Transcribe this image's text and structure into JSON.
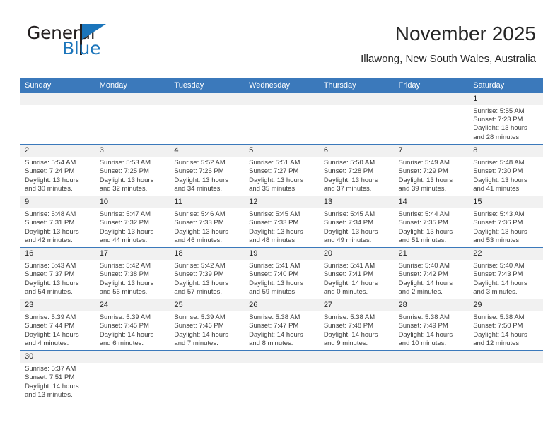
{
  "brand": {
    "name_part1": "General",
    "name_part2": "Blue",
    "flag_icon": "triangle-flag-icon",
    "accent_color": "#1b75bb"
  },
  "header": {
    "title": "November 2025",
    "subtitle": "Illawong, New South Wales, Australia"
  },
  "calendar": {
    "header_color": "#3b79bb",
    "daynum_band_color": "#f1f1f1",
    "weekdays": [
      "Sunday",
      "Monday",
      "Tuesday",
      "Wednesday",
      "Thursday",
      "Friday",
      "Saturday"
    ],
    "weeks": [
      [
        {
          "day": ""
        },
        {
          "day": ""
        },
        {
          "day": ""
        },
        {
          "day": ""
        },
        {
          "day": ""
        },
        {
          "day": ""
        },
        {
          "day": "1",
          "sunrise": "Sunrise: 5:55 AM",
          "sunset": "Sunset: 7:23 PM",
          "daylight_line1": "Daylight: 13 hours",
          "daylight_line2": "and 28 minutes."
        }
      ],
      [
        {
          "day": "2",
          "sunrise": "Sunrise: 5:54 AM",
          "sunset": "Sunset: 7:24 PM",
          "daylight_line1": "Daylight: 13 hours",
          "daylight_line2": "and 30 minutes."
        },
        {
          "day": "3",
          "sunrise": "Sunrise: 5:53 AM",
          "sunset": "Sunset: 7:25 PM",
          "daylight_line1": "Daylight: 13 hours",
          "daylight_line2": "and 32 minutes."
        },
        {
          "day": "4",
          "sunrise": "Sunrise: 5:52 AM",
          "sunset": "Sunset: 7:26 PM",
          "daylight_line1": "Daylight: 13 hours",
          "daylight_line2": "and 34 minutes."
        },
        {
          "day": "5",
          "sunrise": "Sunrise: 5:51 AM",
          "sunset": "Sunset: 7:27 PM",
          "daylight_line1": "Daylight: 13 hours",
          "daylight_line2": "and 35 minutes."
        },
        {
          "day": "6",
          "sunrise": "Sunrise: 5:50 AM",
          "sunset": "Sunset: 7:28 PM",
          "daylight_line1": "Daylight: 13 hours",
          "daylight_line2": "and 37 minutes."
        },
        {
          "day": "7",
          "sunrise": "Sunrise: 5:49 AM",
          "sunset": "Sunset: 7:29 PM",
          "daylight_line1": "Daylight: 13 hours",
          "daylight_line2": "and 39 minutes."
        },
        {
          "day": "8",
          "sunrise": "Sunrise: 5:48 AM",
          "sunset": "Sunset: 7:30 PM",
          "daylight_line1": "Daylight: 13 hours",
          "daylight_line2": "and 41 minutes."
        }
      ],
      [
        {
          "day": "9",
          "sunrise": "Sunrise: 5:48 AM",
          "sunset": "Sunset: 7:31 PM",
          "daylight_line1": "Daylight: 13 hours",
          "daylight_line2": "and 42 minutes."
        },
        {
          "day": "10",
          "sunrise": "Sunrise: 5:47 AM",
          "sunset": "Sunset: 7:32 PM",
          "daylight_line1": "Daylight: 13 hours",
          "daylight_line2": "and 44 minutes."
        },
        {
          "day": "11",
          "sunrise": "Sunrise: 5:46 AM",
          "sunset": "Sunset: 7:33 PM",
          "daylight_line1": "Daylight: 13 hours",
          "daylight_line2": "and 46 minutes."
        },
        {
          "day": "12",
          "sunrise": "Sunrise: 5:45 AM",
          "sunset": "Sunset: 7:33 PM",
          "daylight_line1": "Daylight: 13 hours",
          "daylight_line2": "and 48 minutes."
        },
        {
          "day": "13",
          "sunrise": "Sunrise: 5:45 AM",
          "sunset": "Sunset: 7:34 PM",
          "daylight_line1": "Daylight: 13 hours",
          "daylight_line2": "and 49 minutes."
        },
        {
          "day": "14",
          "sunrise": "Sunrise: 5:44 AM",
          "sunset": "Sunset: 7:35 PM",
          "daylight_line1": "Daylight: 13 hours",
          "daylight_line2": "and 51 minutes."
        },
        {
          "day": "15",
          "sunrise": "Sunrise: 5:43 AM",
          "sunset": "Sunset: 7:36 PM",
          "daylight_line1": "Daylight: 13 hours",
          "daylight_line2": "and 53 minutes."
        }
      ],
      [
        {
          "day": "16",
          "sunrise": "Sunrise: 5:43 AM",
          "sunset": "Sunset: 7:37 PM",
          "daylight_line1": "Daylight: 13 hours",
          "daylight_line2": "and 54 minutes."
        },
        {
          "day": "17",
          "sunrise": "Sunrise: 5:42 AM",
          "sunset": "Sunset: 7:38 PM",
          "daylight_line1": "Daylight: 13 hours",
          "daylight_line2": "and 56 minutes."
        },
        {
          "day": "18",
          "sunrise": "Sunrise: 5:42 AM",
          "sunset": "Sunset: 7:39 PM",
          "daylight_line1": "Daylight: 13 hours",
          "daylight_line2": "and 57 minutes."
        },
        {
          "day": "19",
          "sunrise": "Sunrise: 5:41 AM",
          "sunset": "Sunset: 7:40 PM",
          "daylight_line1": "Daylight: 13 hours",
          "daylight_line2": "and 59 minutes."
        },
        {
          "day": "20",
          "sunrise": "Sunrise: 5:41 AM",
          "sunset": "Sunset: 7:41 PM",
          "daylight_line1": "Daylight: 14 hours",
          "daylight_line2": "and 0 minutes."
        },
        {
          "day": "21",
          "sunrise": "Sunrise: 5:40 AM",
          "sunset": "Sunset: 7:42 PM",
          "daylight_line1": "Daylight: 14 hours",
          "daylight_line2": "and 2 minutes."
        },
        {
          "day": "22",
          "sunrise": "Sunrise: 5:40 AM",
          "sunset": "Sunset: 7:43 PM",
          "daylight_line1": "Daylight: 14 hours",
          "daylight_line2": "and 3 minutes."
        }
      ],
      [
        {
          "day": "23",
          "sunrise": "Sunrise: 5:39 AM",
          "sunset": "Sunset: 7:44 PM",
          "daylight_line1": "Daylight: 14 hours",
          "daylight_line2": "and 4 minutes."
        },
        {
          "day": "24",
          "sunrise": "Sunrise: 5:39 AM",
          "sunset": "Sunset: 7:45 PM",
          "daylight_line1": "Daylight: 14 hours",
          "daylight_line2": "and 6 minutes."
        },
        {
          "day": "25",
          "sunrise": "Sunrise: 5:39 AM",
          "sunset": "Sunset: 7:46 PM",
          "daylight_line1": "Daylight: 14 hours",
          "daylight_line2": "and 7 minutes."
        },
        {
          "day": "26",
          "sunrise": "Sunrise: 5:38 AM",
          "sunset": "Sunset: 7:47 PM",
          "daylight_line1": "Daylight: 14 hours",
          "daylight_line2": "and 8 minutes."
        },
        {
          "day": "27",
          "sunrise": "Sunrise: 5:38 AM",
          "sunset": "Sunset: 7:48 PM",
          "daylight_line1": "Daylight: 14 hours",
          "daylight_line2": "and 9 minutes."
        },
        {
          "day": "28",
          "sunrise": "Sunrise: 5:38 AM",
          "sunset": "Sunset: 7:49 PM",
          "daylight_line1": "Daylight: 14 hours",
          "daylight_line2": "and 10 minutes."
        },
        {
          "day": "29",
          "sunrise": "Sunrise: 5:38 AM",
          "sunset": "Sunset: 7:50 PM",
          "daylight_line1": "Daylight: 14 hours",
          "daylight_line2": "and 12 minutes."
        }
      ],
      [
        {
          "day": "30",
          "sunrise": "Sunrise: 5:37 AM",
          "sunset": "Sunset: 7:51 PM",
          "daylight_line1": "Daylight: 14 hours",
          "daylight_line2": "and 13 minutes."
        },
        {
          "day": ""
        },
        {
          "day": ""
        },
        {
          "day": ""
        },
        {
          "day": ""
        },
        {
          "day": ""
        },
        {
          "day": ""
        }
      ]
    ]
  }
}
